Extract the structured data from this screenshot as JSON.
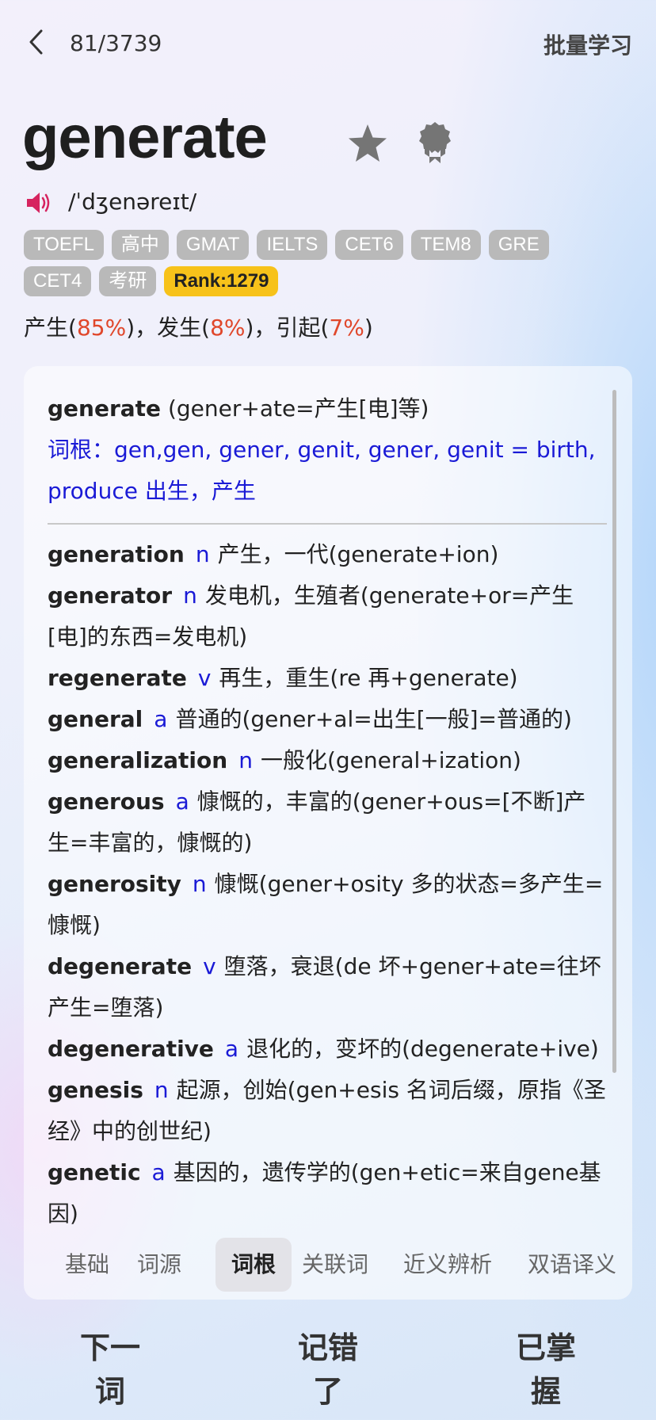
{
  "header": {
    "progress": "81/3739",
    "batch_label": "批量学习"
  },
  "word": {
    "text": "generate",
    "phonetic": "/ˈdʒenəreɪt/"
  },
  "tags": [
    "TOEFL",
    "高中",
    "GMAT",
    "IELTS",
    "CET6",
    "TEM8",
    "GRE",
    "CET4",
    "考研"
  ],
  "rank": "Rank:1279",
  "frequency": [
    {
      "meaning": "产生",
      "pct": "85%"
    },
    {
      "meaning": "发生",
      "pct": "8%"
    },
    {
      "meaning": "引起",
      "pct": "7%"
    }
  ],
  "root_card": {
    "head_word": "generate",
    "head_formula": " (gener+ate=产生[电]等)",
    "root_label": "词根：gen,gen, gener, genit, gener, genit = birth, produce 出生，产生",
    "entries": [
      {
        "word": "generation",
        "pos": "n",
        "def": "产生，一代(generate+ion)"
      },
      {
        "word": "generator",
        "pos": "n",
        "def": "发电机，生殖者(generate+or=产生[电]的东西=发电机)"
      },
      {
        "word": "regenerate",
        "pos": "v",
        "def": "再生，重生(re 再+generate)"
      },
      {
        "word": "general",
        "pos": "a",
        "def": "普通的(gener+al=出生[一般]=普通的)"
      },
      {
        "word": "generalization",
        "pos": "n",
        "def": "一般化(general+ization)"
      },
      {
        "word": "generous",
        "pos": "a",
        "def": "慷慨的，丰富的(gener+ous=[不断]产生=丰富的，慷慨的)"
      },
      {
        "word": "generosity",
        "pos": "n",
        "def": "慷慨(gener+osity 多的状态=多产生=慷慨)"
      },
      {
        "word": "degenerate",
        "pos": "v",
        "def": "堕落，衰退(de 坏+gener+ate=往坏产生=堕落)"
      },
      {
        "word": "degenerative",
        "pos": "a",
        "def": "退化的，变坏的(degenerate+ive)"
      },
      {
        "word": "genesis",
        "pos": "n",
        "def": "起源，创始(gen+esis 名词后缀，原指《圣经》中的创世纪)"
      },
      {
        "word": "genetic",
        "pos": "a",
        "def": "基因的，遗传学的(gen+etic=来自gene基因)"
      }
    ]
  },
  "tabs": [
    "基础",
    "词源",
    "词根",
    "关联词",
    "近义辨析",
    "双语译义"
  ],
  "active_tab": "词根",
  "actions": {
    "next": "下一词",
    "wrong": "记错了",
    "mastered": "已掌握"
  },
  "colors": {
    "accent_blue": "#1a1ad6",
    "pct_red": "#e0472b",
    "rank_yellow": "#f7c21a",
    "next_green": "#2ec36a",
    "wrong_red": "#e04a3c",
    "mastered_orange": "#f0b040"
  }
}
